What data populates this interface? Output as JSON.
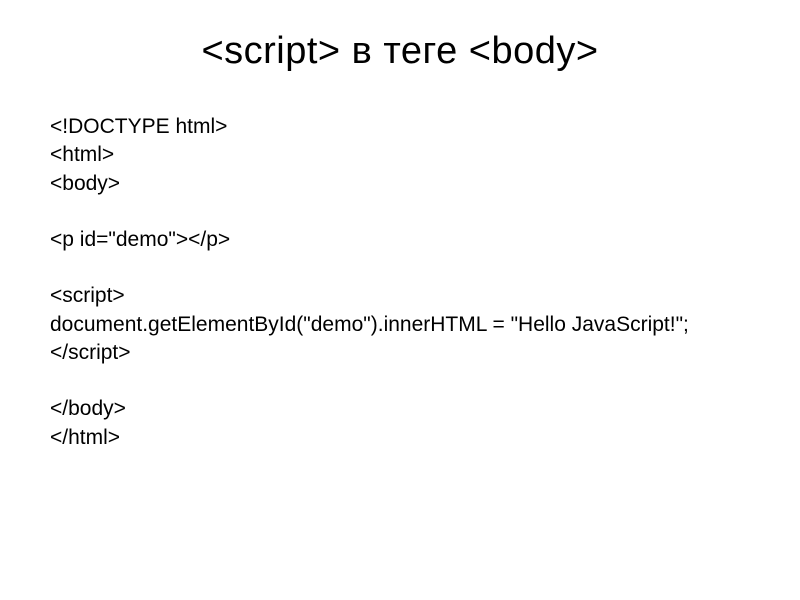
{
  "title": "<script> в теге <body>",
  "code": {
    "line1": "<!DOCTYPE html>",
    "line2": "<html>",
    "line3": "<body>",
    "line4": "<p id=\"demo\"></p>",
    "line5": "<script>",
    "line6": "document.getElementById(\"demo\").innerHTML = \"Hello JavaScript!\";",
    "line7": "</script>",
    "line8": "</body>",
    "line9": "</html>"
  }
}
